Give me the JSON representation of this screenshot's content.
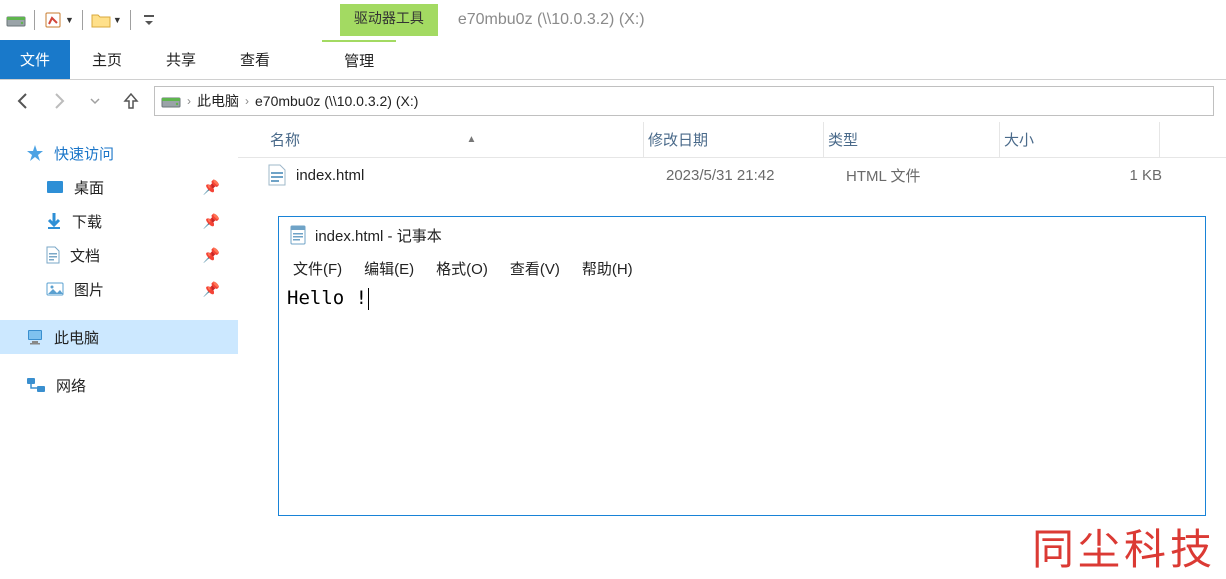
{
  "titlebar": {
    "context_tab": "驱动器工具",
    "window_title": "e70mbu0z (\\\\10.0.3.2) (X:)"
  },
  "ribbon": {
    "file": "文件",
    "home": "主页",
    "share": "共享",
    "view": "查看",
    "manage": "管理"
  },
  "breadcrumb": {
    "root": "此电脑",
    "current": "e70mbu0z (\\\\10.0.3.2) (X:)"
  },
  "sidebar": {
    "quick_access": "快速访问",
    "desktop": "桌面",
    "downloads": "下载",
    "documents": "文档",
    "pictures": "图片",
    "this_pc": "此电脑",
    "network": "网络"
  },
  "columns": {
    "name": "名称",
    "date": "修改日期",
    "type": "类型",
    "size": "大小"
  },
  "files": [
    {
      "name": "index.html",
      "date": "2023/5/31 21:42",
      "type": "HTML 文件",
      "size": "1 KB"
    }
  ],
  "notepad": {
    "title": "index.html - 记事本",
    "menu": {
      "file": "文件(F)",
      "edit": "编辑(E)",
      "format": "格式(O)",
      "view": "查看(V)",
      "help": "帮助(H)"
    },
    "content": "Hello !"
  },
  "watermark": "同尘科技"
}
